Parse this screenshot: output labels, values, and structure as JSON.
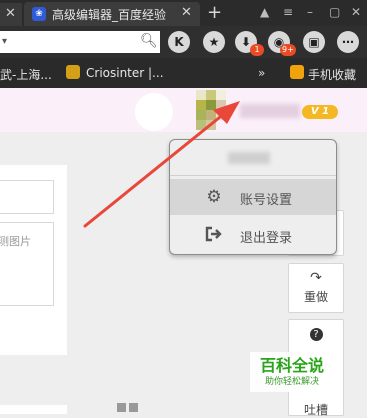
{
  "browser": {
    "active_tab_title": "高级编辑器_百度经验",
    "new_tab_symbol": "+",
    "tab_close_symbol": "✕",
    "prev_tab_close_symbol": "✕",
    "toolbar": {
      "k_button": "K",
      "download_badge": "1",
      "game_badge": "9+"
    },
    "bookmarks": [
      {
        "label": "武-上海...",
        "icon": "bookmark-icon"
      },
      {
        "label": "Criosinter |...",
        "icon": "criosinter-icon"
      },
      {
        "label": "手机收藏",
        "icon": "folder-icon"
      }
    ],
    "more_bookmarks_symbol": "»"
  },
  "header": {
    "level_badge": "V 1",
    "accent_color": "#f4b824"
  },
  "dropdown": {
    "items": [
      {
        "label": "账号设置",
        "icon": "gear-icon"
      },
      {
        "label": "退出登录",
        "icon": "logout-icon"
      }
    ]
  },
  "editor": {
    "image_placeholder": "测图片"
  },
  "sidebar": {
    "redo_label": "重做",
    "help_symbol": "?",
    "feedback_label": "吐槽"
  },
  "watermark": {
    "title": "百科全说",
    "subtitle": "助你轻松解决"
  },
  "colors": {
    "arrow": "#e8473a",
    "header_bg": "#fbeff9",
    "dropdown_hover": "#d6d6d6"
  }
}
